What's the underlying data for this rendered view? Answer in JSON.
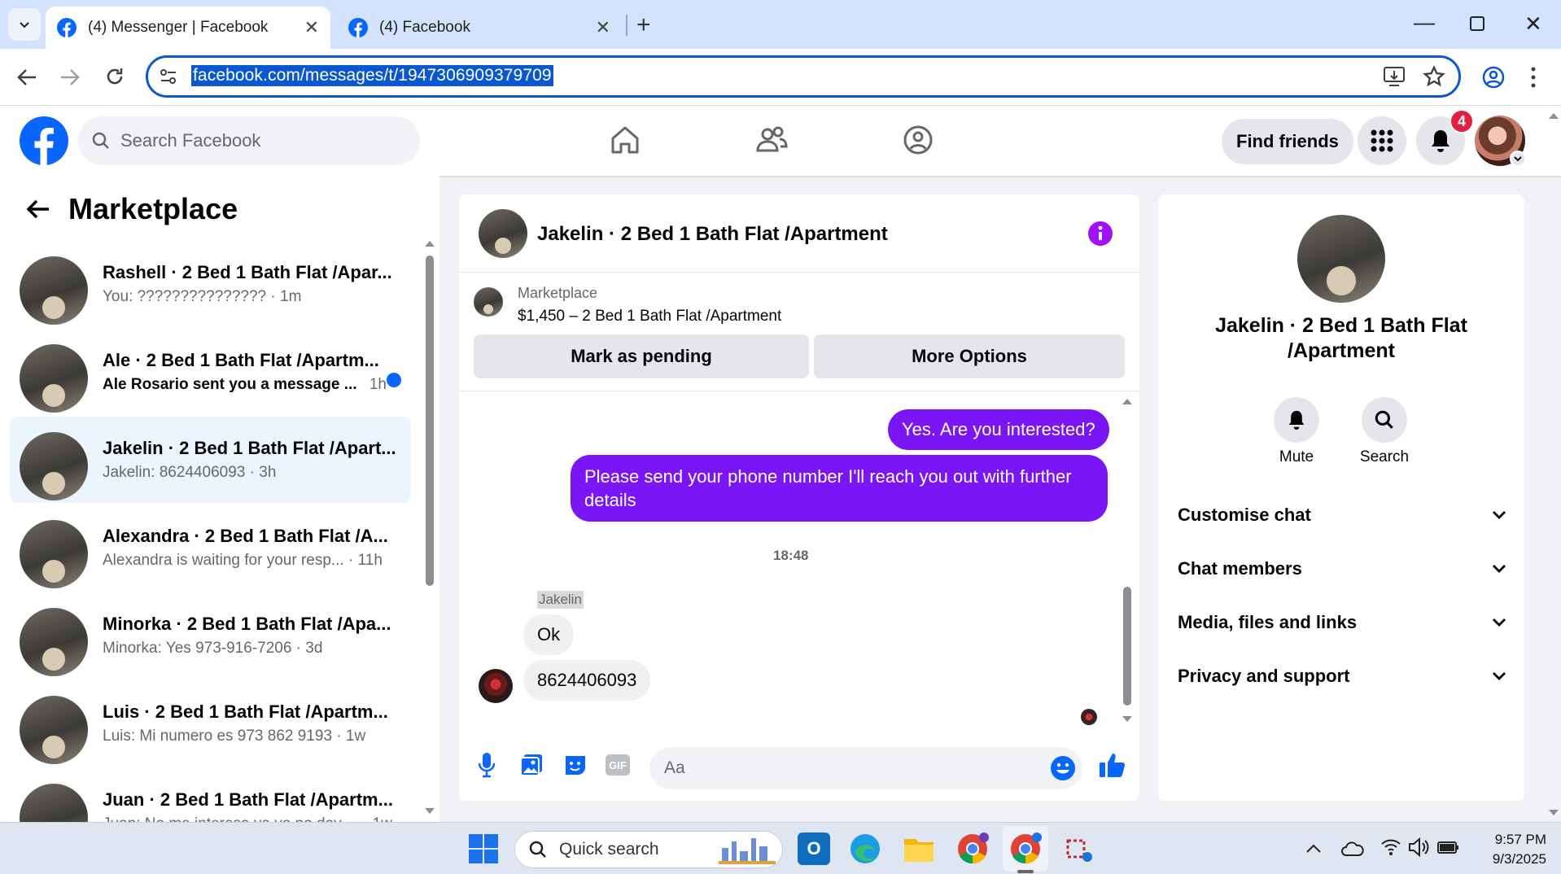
{
  "browser": {
    "tabs": [
      {
        "title": "(4) Messenger | Facebook",
        "active": true
      },
      {
        "title": "(4) Facebook",
        "active": false
      }
    ],
    "url": "facebook.com/messages/t/1947306909379709"
  },
  "header": {
    "search_placeholder": "Search Facebook",
    "find_friends_label": "Find friends",
    "notification_count": "4"
  },
  "sidebar": {
    "title": "Marketplace",
    "conversations": [
      {
        "title": "Rashell · 2 Bed 1 Bath Flat /Apar...",
        "subtitle": "You: ??????????????? · 1m",
        "unread": false,
        "selected": false
      },
      {
        "title": "Ale · 2 Bed 1 Bath Flat /Apartm...",
        "subtitle": "Ale Rosario sent you a message ... ",
        "time": "1h",
        "unread": true,
        "selected": false
      },
      {
        "title": "Jakelin · 2 Bed 1 Bath Flat /Apart...",
        "subtitle": "Jakelin: 8624406093 · 3h",
        "unread": false,
        "selected": true
      },
      {
        "title": "Alexandra · 2 Bed 1 Bath Flat /A...",
        "subtitle": "Alexandra is waiting for your resp... · 11h",
        "unread": false,
        "selected": false
      },
      {
        "title": "Minorka · 2 Bed 1 Bath Flat /Apa...",
        "subtitle": "Minorka: Yes 973-916-7206 · 3d",
        "unread": false,
        "selected": false
      },
      {
        "title": "Luis · 2 Bed 1 Bath Flat /Apartm...",
        "subtitle": "Luis: Mi numero es 973 862 9193 · 1w",
        "unread": false,
        "selected": false
      },
      {
        "title": "Juan · 2 Bed 1 Bath Flat /Apartm...",
        "subtitle": "Juan: No me interesa ya yo no doy ... · 1w",
        "unread": false,
        "selected": false
      }
    ]
  },
  "chat": {
    "title": "Jakelin · 2 Bed 1 Bath Flat /Apartment",
    "listing_source": "Marketplace",
    "listing_detail": "$1,450 – 2 Bed 1 Bath Flat /Apartment",
    "mark_pending_label": "Mark as pending",
    "more_options_label": "More Options",
    "messages": [
      {
        "from": "me",
        "text": "Yes. Are you interested?"
      },
      {
        "from": "me",
        "text": "Please send your phone number  I'll reach you out with further details"
      },
      {
        "from": "them",
        "sender": "Jakelin",
        "text": "Ok"
      },
      {
        "from": "them",
        "text": "8624406093"
      }
    ],
    "timestamp": "18:48",
    "sender_name": "Jakelin",
    "composer_placeholder": "Aa",
    "accent_color": "#7a16f5"
  },
  "info_panel": {
    "name": "Jakelin · 2 Bed 1 Bath Flat /Apartment",
    "mute_label": "Mute",
    "search_label": "Search",
    "sections": [
      "Customise chat",
      "Chat members",
      "Media, files and links",
      "Privacy and support"
    ]
  },
  "taskbar": {
    "search_placeholder": "Quick search",
    "time": "9:57 PM",
    "date": "9/3/2025"
  }
}
